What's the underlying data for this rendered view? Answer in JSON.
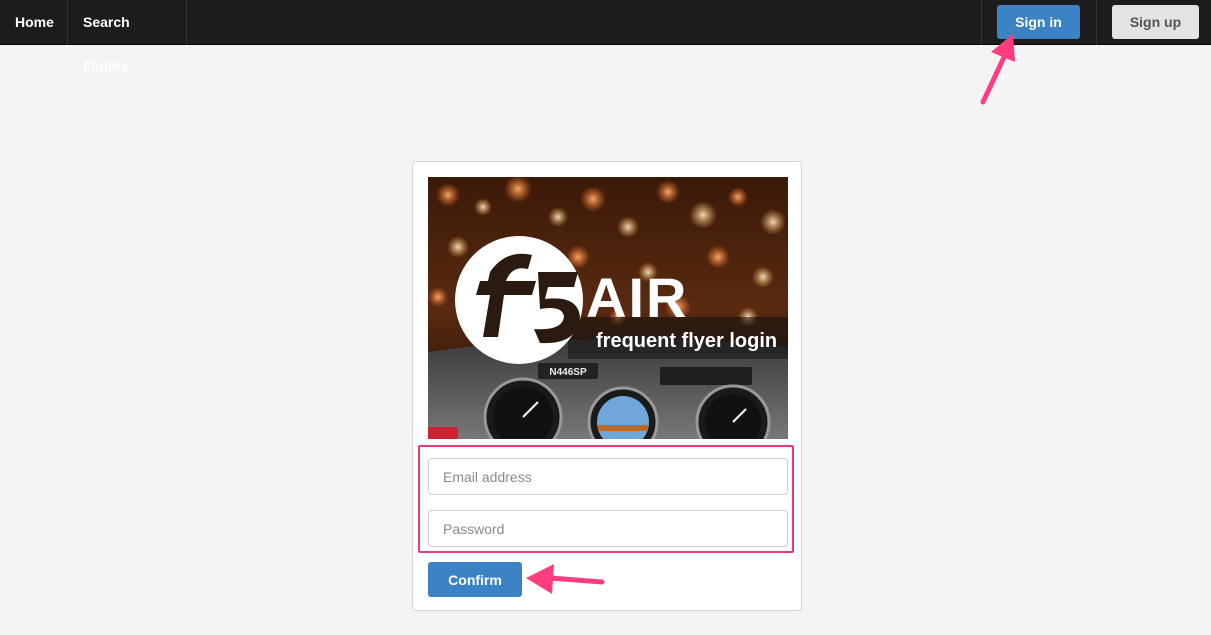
{
  "nav": {
    "home_label": "Home",
    "search_flights_label": "Search Flights",
    "signin_label": "Sign in",
    "signup_label": "Sign up"
  },
  "hero": {
    "logo_text": "AIR",
    "tagline": "frequent flyer login",
    "tail_number": "N446SP"
  },
  "form": {
    "email_placeholder": "Email address",
    "password_placeholder": "Password",
    "email_value": "",
    "password_value": "",
    "confirm_label": "Confirm"
  },
  "colors": {
    "primary": "#3b83c4",
    "annotation": "#e8397a",
    "navbar_bg": "#1c1c1c"
  },
  "icons": [
    "f5-logo-icon",
    "annotation-arrow-icon"
  ]
}
